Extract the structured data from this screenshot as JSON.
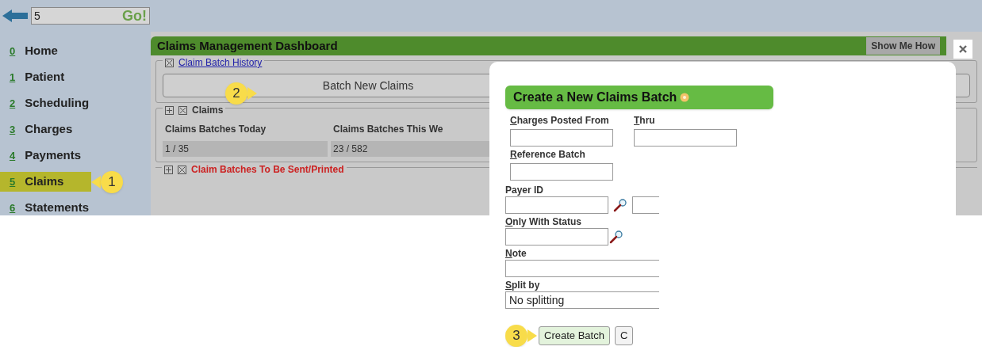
{
  "top_bar": {
    "search_value": "5",
    "go_label": "Go!"
  },
  "sidebar": {
    "items": [
      {
        "number": "0",
        "label": "Home",
        "selected": false
      },
      {
        "number": "1",
        "label": "Patient",
        "selected": false
      },
      {
        "number": "2",
        "label": "Scheduling",
        "selected": false
      },
      {
        "number": "3",
        "label": "Charges",
        "selected": false
      },
      {
        "number": "4",
        "label": "Payments",
        "selected": false
      },
      {
        "number": "5",
        "label": "Claims",
        "selected": true,
        "callout": "1"
      },
      {
        "number": "6",
        "label": "Statements",
        "selected": false
      }
    ]
  },
  "dashboard": {
    "title": "Claims Management Dashboard",
    "help_button": "Show Me How",
    "sections": [
      {
        "kind": "history",
        "title": "Claim Batch History",
        "button": "Batch New Claims",
        "callout": "2"
      },
      {
        "kind": "stats",
        "title": "Claims",
        "columns": [
          "Claims Batches Today",
          "Claims Batches This We"
        ],
        "values": [
          "1 / 35",
          "23 / 582"
        ]
      },
      {
        "kind": "alert",
        "title": "Claim Batches To Be Sent/Printed"
      }
    ]
  },
  "dialog": {
    "title": "Create a New Claims Batch",
    "top_fields": [
      {
        "key": "C",
        "rest": "harges Posted From"
      },
      {
        "key": "T",
        "rest": "hru"
      }
    ],
    "reference": {
      "key": "R",
      "rest": "eference Batch"
    },
    "fields": [
      {
        "kind": "payer",
        "rest": "Payer ID"
      },
      {
        "kind": "lookup",
        "key": "O",
        "rest": "nly With Status"
      },
      {
        "kind": "text",
        "key": "N",
        "rest": "ote"
      },
      {
        "kind": "select",
        "key": "S",
        "rest": "plit by",
        "value": "No splitting"
      }
    ],
    "buttons": [
      {
        "label": "Create Batch",
        "callout": "3",
        "primary": true
      },
      {
        "label": "C",
        "primary": false
      }
    ]
  }
}
